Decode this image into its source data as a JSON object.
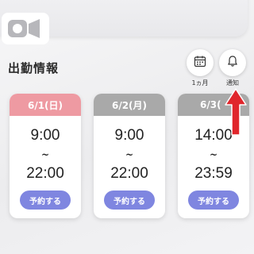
{
  "header": {
    "title": "出勤情報",
    "calendar_button_label": "1ヵ月",
    "notify_button_label": "通知"
  },
  "shifts": [
    {
      "date": "6/1(日)",
      "start": "9:00",
      "separator": "~",
      "end": "22:00",
      "button": "予約する",
      "header_color": "#ee9aa2"
    },
    {
      "date": "6/2(月)",
      "start": "9:00",
      "separator": "~",
      "end": "22:00",
      "button": "予約する",
      "header_color": "#a9a9a9"
    },
    {
      "date": "6/3(",
      "start": "14:00",
      "separator": "~",
      "end": "23:59",
      "button": "予約する",
      "header_color": "#a9a9a9"
    }
  ],
  "colors": {
    "accent_button": "#7f86e0",
    "arrow": "#e0262c"
  },
  "icons": {
    "top_left": "video-camera-icon",
    "calendar": "calendar-icon",
    "notify": "bell-icon",
    "annotation": "red-arrow-icon"
  }
}
